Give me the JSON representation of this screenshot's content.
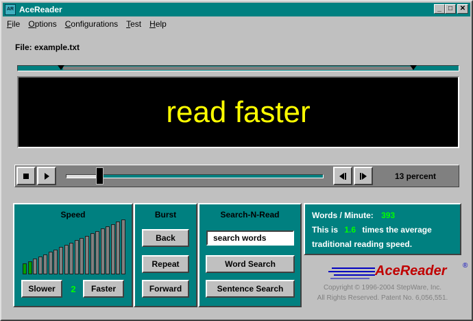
{
  "window": {
    "title": "AceReader",
    "icon_label": "AR",
    "minimize_icon": "minimize-icon",
    "maximize_icon": "maximize-icon",
    "close_icon": "close-icon",
    "minimize_glyph": "_",
    "maximize_glyph": "□",
    "close_glyph": "✕"
  },
  "menu": [
    {
      "label": "File",
      "u": "F",
      "rest": "ile"
    },
    {
      "label": "Options",
      "u": "O",
      "rest": "ptions"
    },
    {
      "label": "Configurations",
      "u": "C",
      "rest": "onfigurations"
    },
    {
      "label": "Test",
      "u": "T",
      "rest": "est"
    },
    {
      "label": "Help",
      "u": "H",
      "rest": "elp"
    }
  ],
  "file_label": "File: example.txt",
  "display_text": "read faster",
  "controls": {
    "stop_icon": "stop-icon",
    "play_icon": "play-icon",
    "step_back_icon": "step-back-icon",
    "step_forward_icon": "step-forward-icon",
    "progress_fraction": 0.13,
    "percent_label": "13 percent"
  },
  "speed": {
    "title": "Speed",
    "level": 2,
    "level_label": "2",
    "bar_count": 20,
    "slower_label": "Slower",
    "faster_label": "Faster"
  },
  "burst": {
    "title": "Burst",
    "back_label": "Back",
    "repeat_label": "Repeat",
    "forward_label": "Forward"
  },
  "search": {
    "title": "Search-N-Read",
    "input_value": "search words",
    "word_search_label": "Word Search",
    "sentence_search_label": "Sentence Search"
  },
  "stats": {
    "wpm_label": "Words / Minute:",
    "wpm_value": "393",
    "this_is": "This is",
    "multiplier": "1.6",
    "times_text": "times the average",
    "line3": "traditional reading speed."
  },
  "brand": {
    "logo_text": "AceReader",
    "reg_mark": "®",
    "copyright_line1": "Copyright © 1996-2004 StepWare, Inc.",
    "copyright_line2": "All Rights Reserved.  Patent No. 6,056,551."
  },
  "colors": {
    "teal": "#008080",
    "display_text": "#ffff00",
    "highlight_green": "#00ff00",
    "logo_red": "#c00000"
  }
}
